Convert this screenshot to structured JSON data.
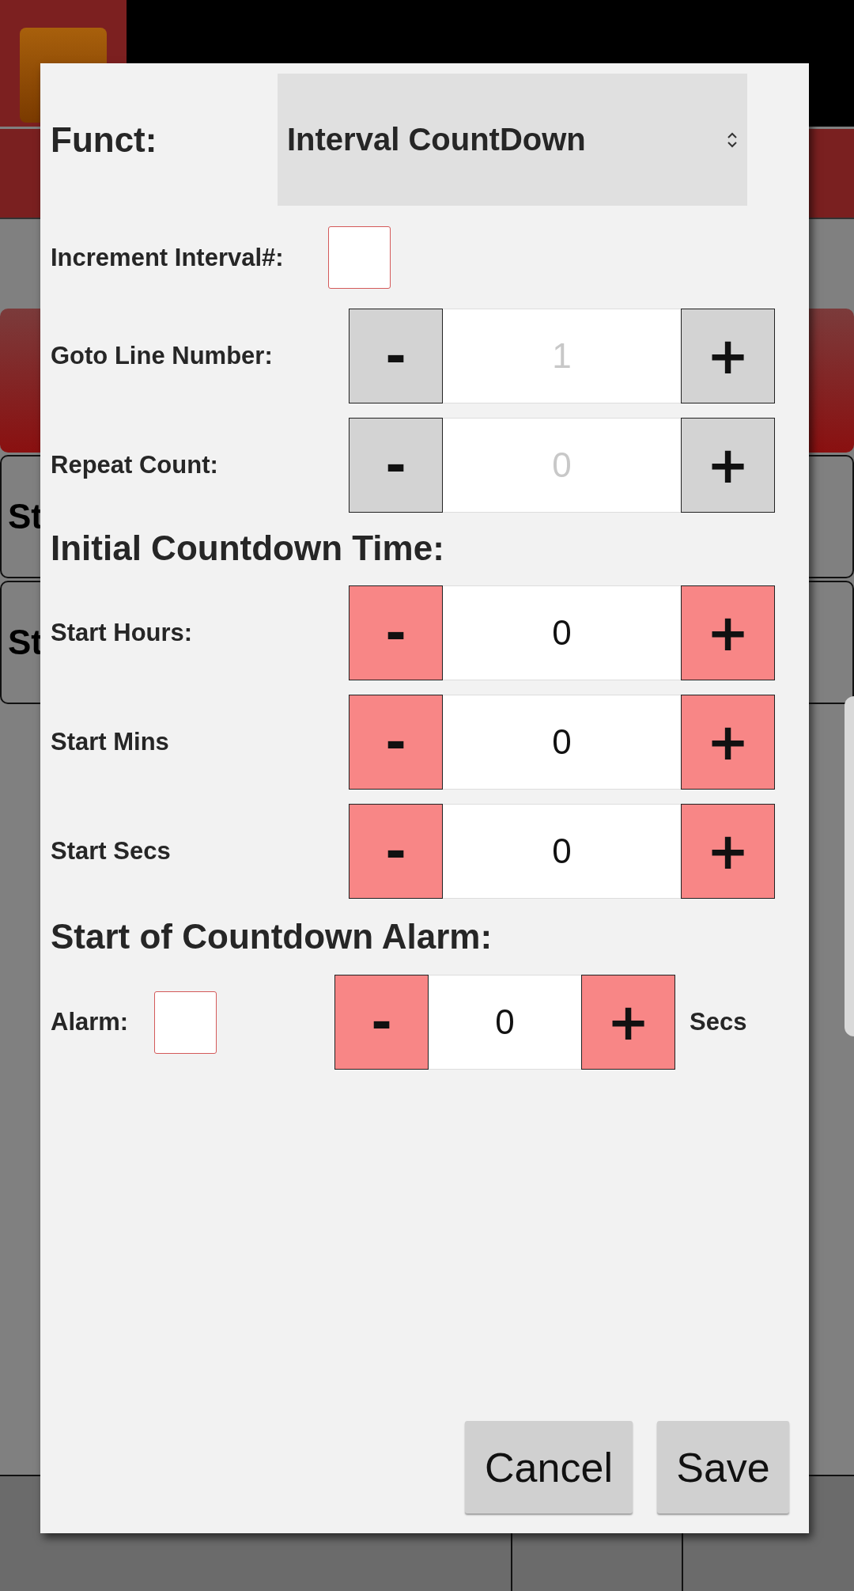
{
  "background": {
    "side_buttons": [
      {
        "label": "St"
      },
      {
        "label": "St"
      }
    ]
  },
  "dialog": {
    "funct": {
      "label": "Funct:",
      "value": "Interval CountDown"
    },
    "increment_interval": {
      "label": "Increment Interval#:",
      "checked": false
    },
    "line_fields": [
      {
        "label": "Goto Line Number:",
        "minus": "-",
        "value": "1",
        "plus": "+",
        "disabled": true
      },
      {
        "label": "Repeat Count:",
        "minus": "-",
        "value": "0",
        "plus": "+",
        "disabled": true
      }
    ],
    "initial_countdown": {
      "heading": "Initial Countdown Time:",
      "fields": [
        {
          "label": "Start Hours:",
          "minus": "-",
          "value": "0",
          "plus": "+",
          "disabled": false
        },
        {
          "label": "Start Mins",
          "minus": "-",
          "value": "0",
          "plus": "+",
          "disabled": false
        },
        {
          "label": "Start Secs",
          "minus": "-",
          "value": "0",
          "plus": "+",
          "disabled": false
        }
      ]
    },
    "countdown_alarm": {
      "heading": "Start of Countdown Alarm:",
      "alarm": {
        "label": "Alarm:",
        "checked": false,
        "minus": "-",
        "value": "0",
        "plus": "+",
        "disabled": false,
        "unit": "Secs"
      }
    },
    "buttons": [
      "Cancel",
      "Save"
    ]
  }
}
